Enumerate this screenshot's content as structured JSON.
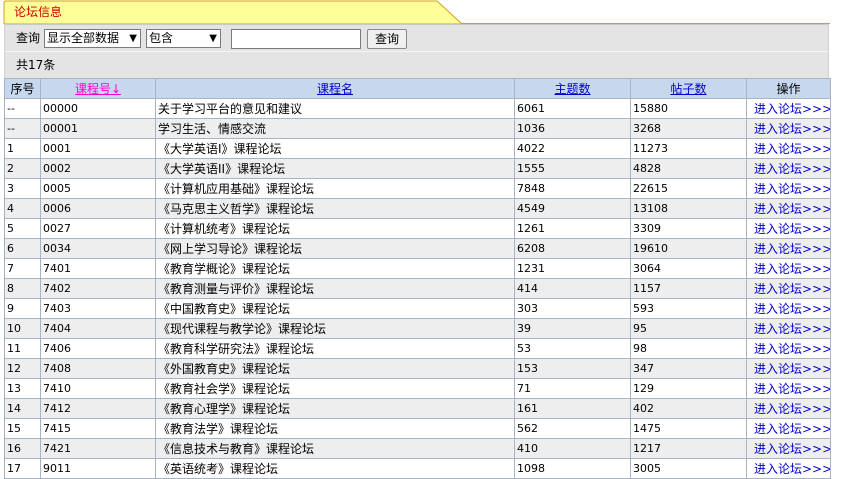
{
  "tab": {
    "title": "论坛信息"
  },
  "search": {
    "label": "查询",
    "scope_value": "显示全部数据",
    "match_value": "包含",
    "keyword_value": "",
    "button_label": "查询"
  },
  "summary": {
    "count_text": "共17条"
  },
  "table": {
    "headers": {
      "index": "序号",
      "code": "课程号↓",
      "name": "课程名",
      "topics": "主题数",
      "posts": "帖子数",
      "action": "操作"
    },
    "rows": [
      {
        "index": "--",
        "code": "00000",
        "name": "关于学习平台的意见和建议",
        "topics": "6061",
        "posts": "15880",
        "action": "进入论坛>>>"
      },
      {
        "index": "--",
        "code": "00001",
        "name": "学习生活、情感交流",
        "topics": "1036",
        "posts": "3268",
        "action": "进入论坛>>>"
      },
      {
        "index": "1",
        "code": "0001",
        "name": "《大学英语I》课程论坛",
        "topics": "4022",
        "posts": "11273",
        "action": "进入论坛>>>"
      },
      {
        "index": "2",
        "code": "0002",
        "name": "《大学英语II》课程论坛",
        "topics": "1555",
        "posts": "4828",
        "action": "进入论坛>>>"
      },
      {
        "index": "3",
        "code": "0005",
        "name": "《计算机应用基础》课程论坛",
        "topics": "7848",
        "posts": "22615",
        "action": "进入论坛>>>"
      },
      {
        "index": "4",
        "code": "0006",
        "name": "《马克思主义哲学》课程论坛",
        "topics": "4549",
        "posts": "13108",
        "action": "进入论坛>>>"
      },
      {
        "index": "5",
        "code": "0027",
        "name": "《计算机统考》课程论坛",
        "topics": "1261",
        "posts": "3309",
        "action": "进入论坛>>>"
      },
      {
        "index": "6",
        "code": "0034",
        "name": "《网上学习导论》课程论坛",
        "topics": "6208",
        "posts": "19610",
        "action": "进入论坛>>>"
      },
      {
        "index": "7",
        "code": "7401",
        "name": "《教育学概论》课程论坛",
        "topics": "1231",
        "posts": "3064",
        "action": "进入论坛>>>"
      },
      {
        "index": "8",
        "code": "7402",
        "name": "《教育测量与评价》课程论坛",
        "topics": "414",
        "posts": "1157",
        "action": "进入论坛>>>"
      },
      {
        "index": "9",
        "code": "7403",
        "name": "《中国教育史》课程论坛",
        "topics": "303",
        "posts": "593",
        "action": "进入论坛>>>"
      },
      {
        "index": "10",
        "code": "7404",
        "name": "《现代课程与教学论》课程论坛",
        "topics": "39",
        "posts": "95",
        "action": "进入论坛>>>"
      },
      {
        "index": "11",
        "code": "7406",
        "name": "《教育科学研究法》课程论坛",
        "topics": "53",
        "posts": "98",
        "action": "进入论坛>>>"
      },
      {
        "index": "12",
        "code": "7408",
        "name": "《外国教育史》课程论坛",
        "topics": "153",
        "posts": "347",
        "action": "进入论坛>>>"
      },
      {
        "index": "13",
        "code": "7410",
        "name": "《教育社会学》课程论坛",
        "topics": "71",
        "posts": "129",
        "action": "进入论坛>>>"
      },
      {
        "index": "14",
        "code": "7412",
        "name": "《教育心理学》课程论坛",
        "topics": "161",
        "posts": "402",
        "action": "进入论坛>>>"
      },
      {
        "index": "15",
        "code": "7415",
        "name": "《教育法学》课程论坛",
        "topics": "562",
        "posts": "1475",
        "action": "进入论坛>>>"
      },
      {
        "index": "16",
        "code": "7421",
        "name": "《信息技术与教育》课程论坛",
        "topics": "410",
        "posts": "1217",
        "action": "进入论坛>>>"
      },
      {
        "index": "17",
        "code": "9011",
        "name": "《英语统考》课程论坛",
        "topics": "1098",
        "posts": "3005",
        "action": "进入论坛>>>"
      }
    ]
  },
  "colors": {
    "tab_fill": "#ffff99",
    "tab_border": "#d4a017",
    "title_text": "#cc0000",
    "header_bg": "#c7d8ee",
    "link": "#0000cc",
    "sorted_link": "#ff00cc"
  },
  "icons": {
    "dropdown": "dropdown-arrow-icon"
  }
}
